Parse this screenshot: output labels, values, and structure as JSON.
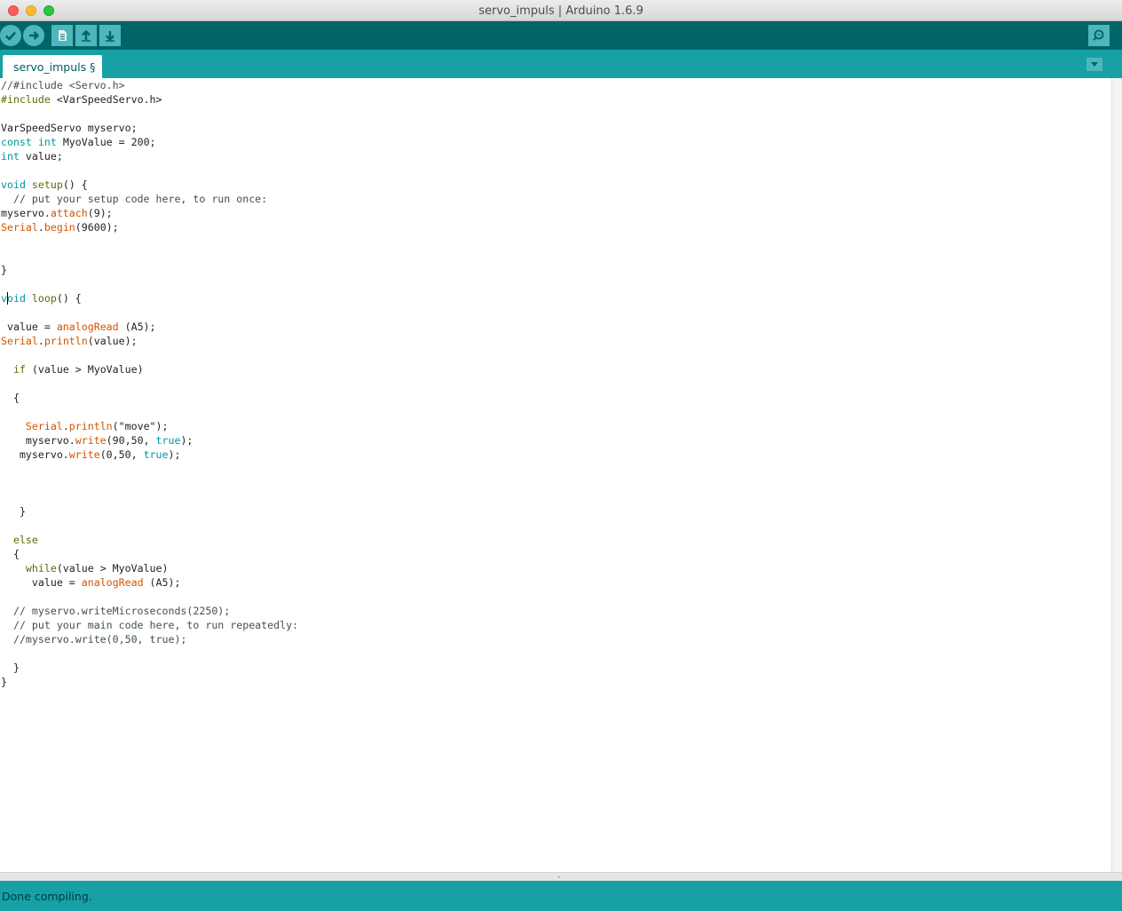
{
  "window": {
    "title": "servo_impuls | Arduino 1.6.9"
  },
  "toolbar": {
    "icons": {
      "verify": "checkmark-icon",
      "upload": "arrow-right-icon",
      "new": "document-icon",
      "open": "arrow-up-icon",
      "save": "arrow-down-icon",
      "serial_monitor": "magnifier-icon"
    }
  },
  "tabs": [
    {
      "label": "servo_impuls §"
    }
  ],
  "code": {
    "lines": [
      [
        [
          "cm",
          "//#include <Servo.h>"
        ]
      ],
      [
        [
          "pp",
          "#include"
        ],
        [
          "",
          " <VarSpeedServo.h>"
        ]
      ],
      [],
      [
        [
          "",
          "VarSpeedServo myservo;"
        ]
      ],
      [
        [
          "kw",
          "const"
        ],
        [
          "",
          " "
        ],
        [
          "kw",
          "int"
        ],
        [
          "",
          " MyoValue = 200;"
        ]
      ],
      [
        [
          "kw",
          "int"
        ],
        [
          "",
          " value;"
        ]
      ],
      [],
      [
        [
          "kw",
          "void"
        ],
        [
          "",
          " "
        ],
        [
          "pp",
          "setup"
        ],
        [
          "",
          "() {"
        ]
      ],
      [
        [
          "cm",
          "  // put your setup code here, to run once:"
        ]
      ],
      [
        [
          "",
          "myservo."
        ],
        [
          "fn",
          "attach"
        ],
        [
          "",
          "(9);"
        ]
      ],
      [
        [
          "fn",
          "Serial"
        ],
        [
          "",
          "."
        ],
        [
          "fn",
          "begin"
        ],
        [
          "",
          "(9600);"
        ]
      ],
      [],
      [],
      [
        [
          "",
          "}"
        ]
      ],
      [],
      [
        [
          "kw",
          "v"
        ],
        [
          "caret",
          ""
        ],
        [
          "kw",
          "oid"
        ],
        [
          "",
          " "
        ],
        [
          "pp",
          "loop"
        ],
        [
          "",
          "() {"
        ]
      ],
      [],
      [
        [
          "",
          " value = "
        ],
        [
          "fn",
          "analogRead"
        ],
        [
          "",
          " (A5);"
        ]
      ],
      [
        [
          "fn",
          "Serial"
        ],
        [
          "",
          "."
        ],
        [
          "fn",
          "println"
        ],
        [
          "",
          "(value);"
        ]
      ],
      [],
      [
        [
          "",
          "  "
        ],
        [
          "pp",
          "if"
        ],
        [
          "",
          " (value > MyoValue)"
        ]
      ],
      [],
      [
        [
          "",
          "  {"
        ]
      ],
      [],
      [
        [
          "",
          "    "
        ],
        [
          "fn",
          "Serial"
        ],
        [
          "",
          "."
        ],
        [
          "fn",
          "println"
        ],
        [
          "",
          "(\"move\");"
        ]
      ],
      [
        [
          "",
          "    myservo."
        ],
        [
          "fn",
          "write"
        ],
        [
          "",
          "(90,50, "
        ],
        [
          "kw",
          "true"
        ],
        [
          "",
          ");"
        ]
      ],
      [
        [
          "",
          "   myservo."
        ],
        [
          "fn",
          "write"
        ],
        [
          "",
          "(0,50, "
        ],
        [
          "kw",
          "true"
        ],
        [
          "",
          ");"
        ]
      ],
      [],
      [],
      [],
      [
        [
          "",
          "   }"
        ]
      ],
      [],
      [
        [
          "",
          "  "
        ],
        [
          "pp",
          "else"
        ]
      ],
      [
        [
          "",
          "  {"
        ]
      ],
      [
        [
          "",
          "    "
        ],
        [
          "pp",
          "while"
        ],
        [
          "",
          "(value > MyoValue)"
        ]
      ],
      [
        [
          "",
          "     value = "
        ],
        [
          "fn",
          "analogRead"
        ],
        [
          "",
          " (A5);"
        ]
      ],
      [],
      [
        [
          "cm",
          "  // myservo.writeMicroseconds(2250);"
        ]
      ],
      [
        [
          "cm",
          "  // put your main code here, to run repeatedly:"
        ]
      ],
      [
        [
          "cm",
          "  //myservo.write(0,50, true);"
        ]
      ],
      [],
      [
        [
          "",
          "  }"
        ]
      ],
      [
        [
          "",
          "}"
        ]
      ]
    ]
  },
  "status": {
    "message": "Done compiling."
  }
}
